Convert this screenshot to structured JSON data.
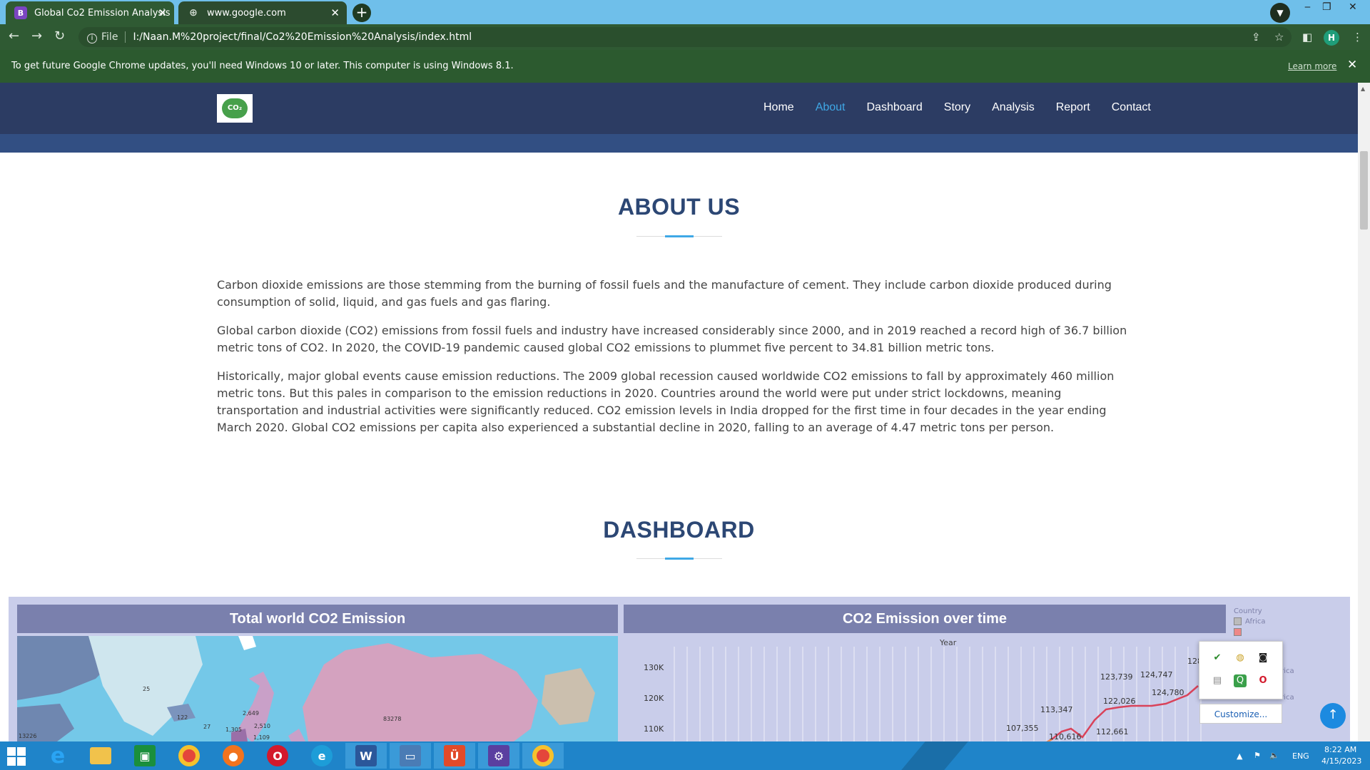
{
  "browser": {
    "tabs": [
      {
        "favicon": "B",
        "title": "Global Co2 Emission Analysis"
      },
      {
        "favicon": "globe",
        "title": "www.google.com"
      }
    ],
    "address": {
      "prefix": "File",
      "url": "I:/Naan.M%20project/final/Co2%20Emission%20Analysis/index.html"
    },
    "profile_initial": "H",
    "infobar": {
      "message": "To get future Google Chrome updates, you'll need Windows 10 or later. This computer is using Windows 8.1.",
      "link": "Learn more"
    }
  },
  "site": {
    "logo_text": "CO₂",
    "nav": [
      "Home",
      "About",
      "Dashboard",
      "Story",
      "Analysis",
      "Report",
      "Contact"
    ],
    "active_nav": "About",
    "accent_color": "#3fa8e6",
    "header_color": "#2c3c63"
  },
  "about": {
    "title": "ABOUT US",
    "paragraphs": [
      "Carbon dioxide emissions are those stemming from the burning of fossil fuels and the manufacture of cement. They include carbon dioxide produced during consumption of solid, liquid, and gas fuels and gas flaring.",
      "Global carbon dioxide (CO2) emissions from fossil fuels and industry have increased considerably since 2000, and in 2019 reached a record high of 36.7 billion metric tons of CO2. In 2020, the COVID-19 pandemic caused global CO2 emissions to plummet five percent to 34.81 billion metric tons.",
      "Historically, major global events cause emission reductions. The 2009 global recession caused worldwide CO2 emissions to fall by approximately 460 million metric tons. But this pales in comparison to the emission reductions in 2020. Countries around the world were put under strict lockdowns, meaning transportation and industrial activities were significantly reduced. CO2 emission levels in India dropped for the first time in four decades in the year ending March 2020. Global CO2 emissions per capita also experienced a substantial decline in 2020, falling to an average of 4.47 metric tons per person."
    ]
  },
  "dashboard": {
    "title": "DASHBOARD",
    "map_panel": {
      "title": "Total world CO2 Emission",
      "labels": [
        "25",
        "122",
        "27",
        "2,649",
        "1,305",
        "2,510",
        "83278",
        "1,109",
        "13226"
      ]
    },
    "time_panel": {
      "title": "CO2 Emission over time",
      "x_axis_title": "Year",
      "y_ticks": [
        "130K",
        "120K",
        "110K"
      ],
      "data_labels": [
        "107,355",
        "113,347",
        "110,616",
        "112,661",
        "122,026",
        "123,739",
        "124,747",
        "124,780",
        "128,"
      ]
    },
    "legend": {
      "title": "Country",
      "items": [
        "Africa"
      ],
      "partial": [
        "erica",
        "erica"
      ]
    }
  },
  "tray_popup": {
    "customize": "Customize..."
  },
  "taskbar": {
    "language": "ENG",
    "time": "8:22 AM",
    "date": "4/15/2023"
  }
}
